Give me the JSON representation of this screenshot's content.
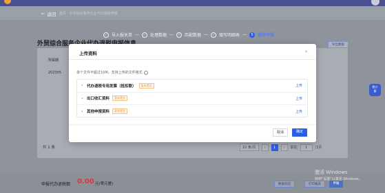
{
  "header": {
    "back_label": "返回",
    "breadcrumb": "首页 · 外贸综合服务企业代办退税申报"
  },
  "steps": [
    {
      "label": "导入报关单"
    },
    {
      "label": "处理数据"
    },
    {
      "label": "匹配数据"
    },
    {
      "label": "填写明细表"
    },
    {
      "label": "提交申报",
      "number": "5"
    }
  ],
  "page": {
    "title": "外贸综合服务企业代办退税申报信息",
    "topright_button": "导出数据",
    "table_header_first": "所属期",
    "table_row_first": "202305",
    "total": "共 1 条"
  },
  "pagination": {
    "page_size": "10 条/页",
    "current_page": "1",
    "goto_label": "前往",
    "goto_value": "1",
    "page_suffix": "/1页"
  },
  "modal": {
    "title": "上传资料",
    "note": "单个文件不超过10M，支持上传的文件格式",
    "items": [
      {
        "label": "代办退税专用发票（抵扣联）",
        "tag": "暂未提交",
        "action": "上传"
      },
      {
        "label": "出口收汇资料",
        "tag": "暂未提交",
        "action": "上传"
      },
      {
        "label": "其他申报资料",
        "tag": "暂未提交",
        "action": "上传"
      }
    ],
    "cancel_label": "取消",
    "confirm_label": "确定"
  },
  "footer": {
    "label": "申报代办退税额",
    "amount": "0.00",
    "unit": "元(零元整)",
    "buttons": [
      "数据校验",
      "打印报表",
      "申报"
    ]
  },
  "watermark": {
    "line1": "激活 Windows",
    "line2": "转到\"设置\"以激活 Windows。"
  },
  "assistant": {
    "label": "税小\n蜜"
  },
  "colors": {
    "primary": "#2b5ee8",
    "amount_red": "#d9363e",
    "tag_orange": "#e89a3c"
  }
}
